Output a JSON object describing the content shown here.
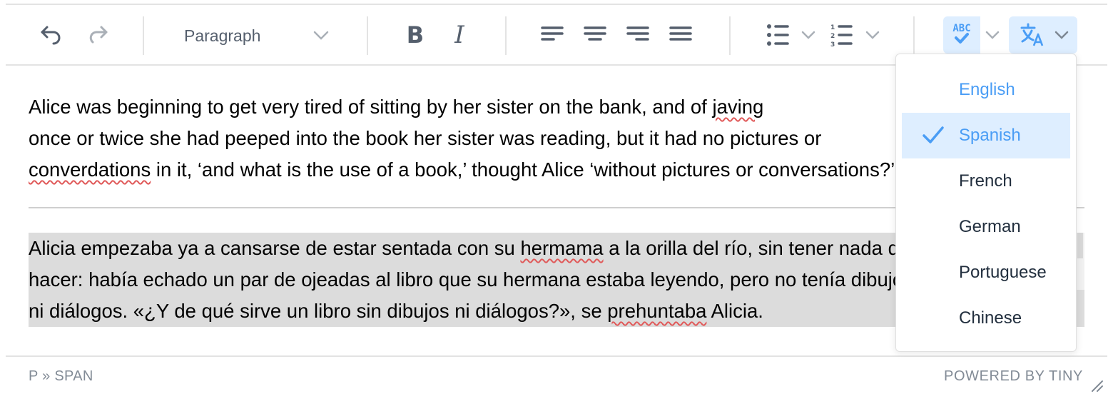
{
  "toolbar": {
    "undo": {
      "icon": "undo-icon",
      "enabled": true
    },
    "redo": {
      "icon": "redo-icon",
      "enabled": false
    },
    "blocks": {
      "label": "Paragraph"
    },
    "bold": {
      "label": "B"
    },
    "italic": {
      "label": "I"
    },
    "align": [
      "align-left",
      "align-center",
      "align-right",
      "align-justify"
    ],
    "lists": [
      "bullet-list",
      "numbered-list"
    ],
    "spellchecker": {
      "icon_text": "ABC",
      "active": true
    },
    "language": {
      "icon": "translate-icon",
      "active": true
    }
  },
  "content": {
    "p1": {
      "l1a": "Alice was beginning to get very tired of sitting by her sister on the bank, and of ",
      "l1b": "javing",
      "l2": "once or twice she had peeped into the book her sister was reading, but it had no pictures or",
      "l3a": "converdations",
      "l3b": " in it, ‘and what is the use of a book,’ thought Alice ‘without pictures or conversations?’"
    },
    "p2": {
      "l1a": "Alicia empezaba ya a cansarse de estar sentada con su ",
      "l1b": "hermama",
      "l1c": " a la orilla del río, sin tener nada que",
      "l2": "hacer: había echado un par de ojeadas al libro que su hermana estaba leyendo, pero no tenía dibujos",
      "l3a": "ni diálogos. «¿Y de qué sirve un libro sin dibujos ni diálogos?», se ",
      "l3b": "prehuntaba",
      "l3c": " Alicia."
    }
  },
  "statusbar": {
    "path": "P » SPAN",
    "branding": "POWERED BY TINY"
  },
  "language_menu": {
    "items": [
      {
        "label": "English",
        "selected": false,
        "highlight": true
      },
      {
        "label": "Spanish",
        "selected": true,
        "highlight": true
      },
      {
        "label": "French",
        "selected": false
      },
      {
        "label": "German",
        "selected": false
      },
      {
        "label": "Portuguese",
        "selected": false
      },
      {
        "label": "Chinese",
        "selected": false
      }
    ]
  },
  "colors": {
    "accent": "#4a9df5",
    "active_bg": "#deeeff",
    "icon": "#555f6d",
    "misspell": "#e05a5a",
    "selection_bg": "#dcdcdc"
  }
}
